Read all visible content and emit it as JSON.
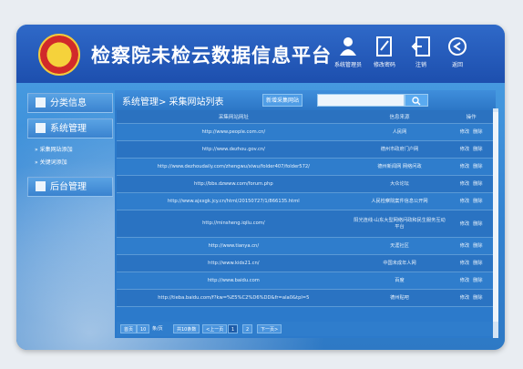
{
  "header": {
    "title": "检察院未检云数据信息平台",
    "buttons": [
      {
        "label": "系统管理员",
        "icon": "user-icon"
      },
      {
        "label": "修改密码",
        "icon": "edit-icon"
      },
      {
        "label": "注销",
        "icon": "logout-icon"
      },
      {
        "label": "返回",
        "icon": "back-icon"
      }
    ]
  },
  "sidebar": {
    "sections": [
      {
        "label": "分类信息",
        "icon": "grid-icon"
      },
      {
        "label": "系统管理",
        "icon": "monitor-icon",
        "items": [
          "采集网站添加",
          "关键词添加"
        ]
      },
      {
        "label": "后台管理",
        "icon": "monitor-icon"
      }
    ]
  },
  "main": {
    "breadcrumb": "系统管理> 采集网站列表",
    "add_button": "新增采集网站",
    "search_placeholder": "",
    "columns": [
      "采集网站网址",
      "信息来源",
      "操作"
    ],
    "rows": [
      {
        "url": "http://www.people.com.cn/",
        "source": "人民网"
      },
      {
        "url": "http://www.dezhou.gov.cn/",
        "source": "德州市政府门户网"
      },
      {
        "url": "http://www.dezhoudaily.com/zhengwu/xiwu/folder407/folder572/",
        "source": "德州新闻网 网络问政"
      },
      {
        "url": "http://bbs.dzwww.com/forum.php",
        "source": "大众论坛"
      },
      {
        "url": "http://www.ajxxgk.jcy.cn/html/20150727/1/866135.html",
        "source": "人民检察院案件信息公开网"
      },
      {
        "url": "http://minsheng.iqilu.com/",
        "source": "阳光连线-山东大型网络问政和民生服务互动平台"
      },
      {
        "url": "http://www.tianya.cn/",
        "source": "天涯社区"
      },
      {
        "url": "http://www.kids21.cn/",
        "source": "中国未成年人网"
      },
      {
        "url": "http://www.baidu.com",
        "source": "百度"
      },
      {
        "url": "http://tieba.baidu.com/f?kw=%E5%C2%D6%DD&fr=ala0&tpl=5",
        "source": "德州贴吧"
      }
    ],
    "ops": [
      "修改",
      "删除"
    ],
    "pager": {
      "first": "首页",
      "prev_pages": "10",
      "size": "条/页",
      "total": "共10条数",
      "prev": "<上一页",
      "page1": "1",
      "page2": "2",
      "next": "下一页>"
    }
  }
}
